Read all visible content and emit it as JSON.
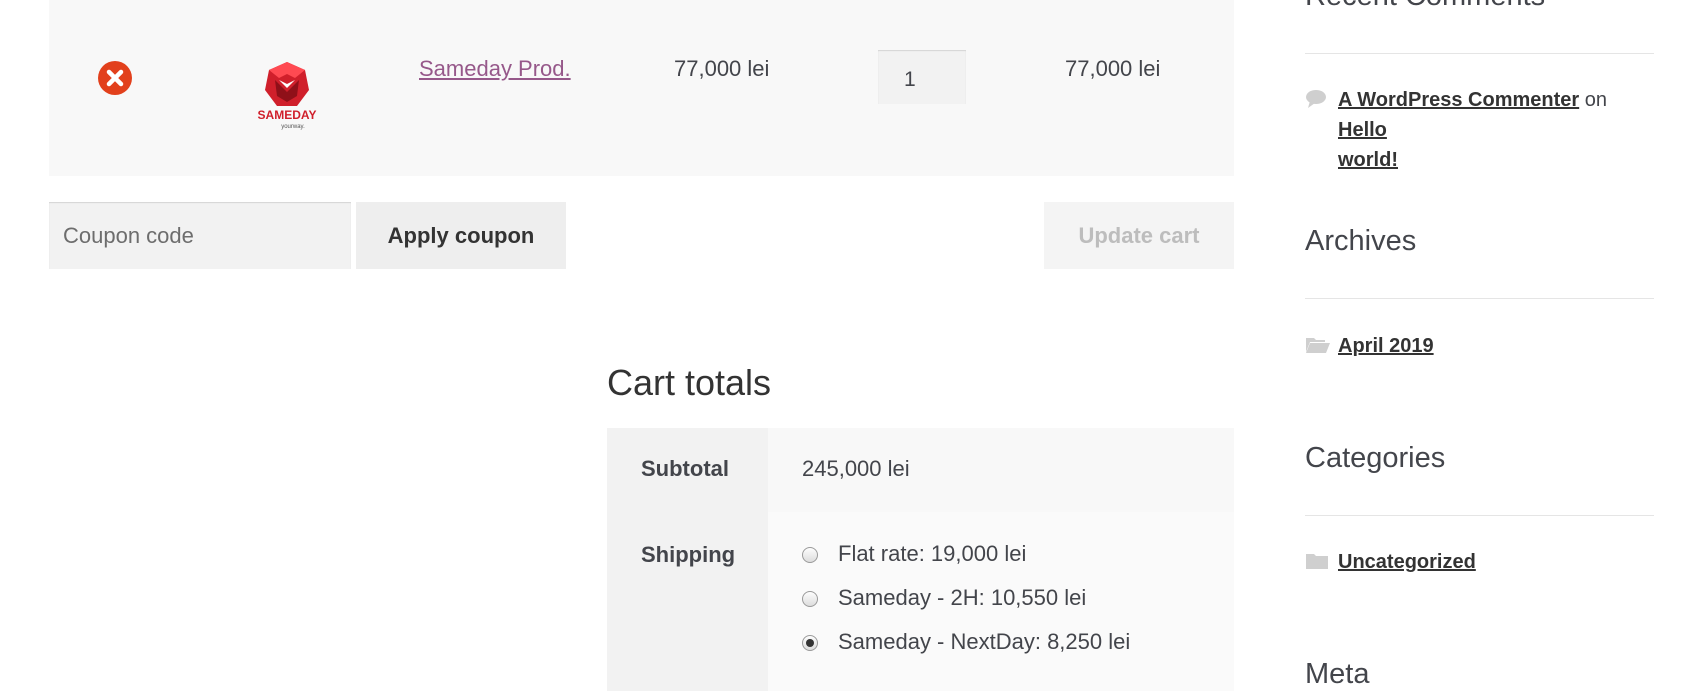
{
  "cart": {
    "item": {
      "product_name": "Sameday Prod.",
      "price": "77,000 lei",
      "quantity": "1",
      "line_total": "77,000 lei",
      "thumbnail_text": "SAMEDAY",
      "thumbnail_tagline": "yourway."
    },
    "coupon_placeholder": "Coupon code",
    "apply_coupon_label": "Apply coupon",
    "update_cart_label": "Update cart"
  },
  "totals": {
    "heading": "Cart totals",
    "subtotal_label": "Subtotal",
    "subtotal_value": "245,000 lei",
    "shipping_label": "Shipping",
    "shipping_options": [
      {
        "label": "Flat rate: 19,000 lei",
        "checked": false
      },
      {
        "label": "Sameday - 2H: 10,550 lei",
        "checked": false
      },
      {
        "label": "Sameday - NextDay: 8,250 lei",
        "checked": true
      }
    ]
  },
  "sidebar": {
    "recent_comments_title": "Recent Comments",
    "comment": {
      "author": "A WordPress Commenter",
      "on": "on",
      "post_line1": "Hello",
      "post_line2": "world!"
    },
    "archives_title": "Archives",
    "archive_item": "April 2019",
    "categories_title": "Categories",
    "category_item": "Uncategorized",
    "meta_title": "Meta"
  },
  "colors": {
    "accent_link": "#96588a",
    "remove_red": "#e2401c",
    "logo_red": "#d01f2b"
  },
  "icons": [
    "remove-icon",
    "comment-bubble-icon",
    "folder-open-icon",
    "folder-icon"
  ]
}
